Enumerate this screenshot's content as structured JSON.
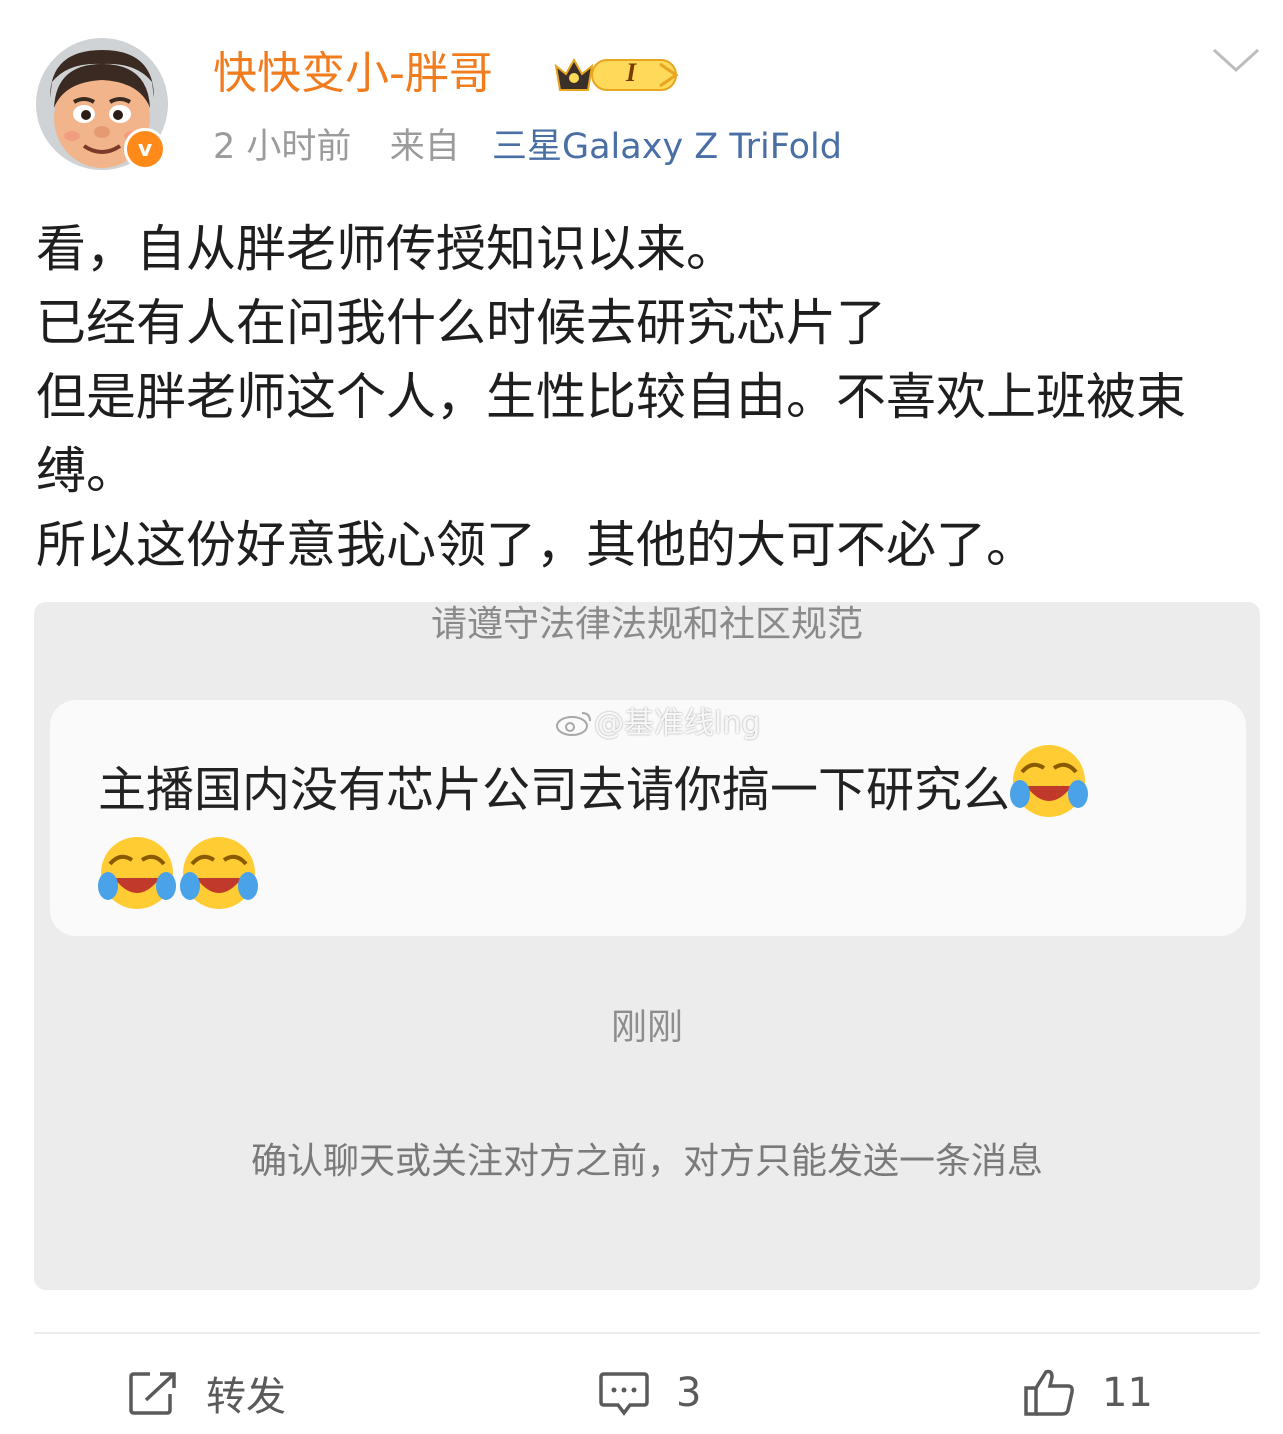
{
  "post": {
    "username": "快快变小-胖哥",
    "level_badge": "I",
    "time": "2 小时前",
    "from_label": "来自",
    "source": "三星Galaxy Z TriFold",
    "body_lines": [
      "看，自从胖老师传授知识以来。",
      "已经有人在问我什么时候去研究芯片了",
      "但是胖老师这个人，生性比较自由。不喜欢上班被束缚。",
      "所以这份好意我心领了，其他的大可不必了。"
    ],
    "icons": {
      "verified": "v-verified-icon",
      "menu": "chevron-down-icon"
    }
  },
  "screenshot": {
    "rules_notice": "请遵守法律法规和社区规范",
    "watermark": "@基准线lng",
    "message": "主播国内没有芯片公司去请你搞一下研究么",
    "message_emojis": [
      "laughing-crying-emoji",
      "laughing-crying-emoji",
      "laughing-crying-emoji"
    ],
    "time": "刚刚",
    "note": "确认聊天或关注对方之前，对方只能发送一条消息"
  },
  "actions": {
    "repost_label": "转发",
    "comments_count": "3",
    "likes_count": "11"
  },
  "colors": {
    "username": "#f07c1e",
    "source_link": "#4a6fa5",
    "meta": "#9b9b9b",
    "verified_badge": "#ff8a1a"
  }
}
